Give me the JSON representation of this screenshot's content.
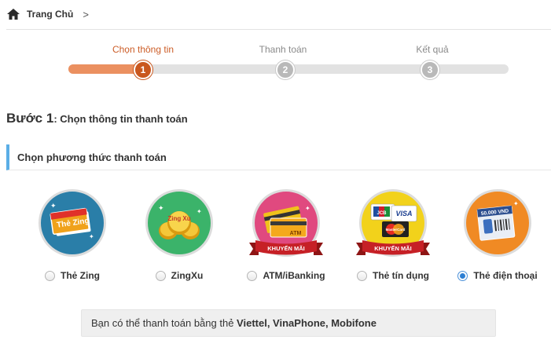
{
  "breadcrumb": {
    "home_label": "Trang Chủ",
    "chevron": ">"
  },
  "steps": [
    {
      "label": "Chọn thông tin",
      "number": "1",
      "active": true
    },
    {
      "label": "Thanh toán",
      "number": "2",
      "active": false
    },
    {
      "label": "Kết quả",
      "number": "3",
      "active": false
    }
  ],
  "progress_fraction": 0.18,
  "step_heading": {
    "prefix": "Bước 1",
    "text": ": Chọn thông tin thanh toán"
  },
  "section_title": "Chọn phương thức thanh toán",
  "methods": [
    {
      "label": "Thẻ Zing",
      "icon": "zing-card-icon",
      "bg": "#2a7ea8",
      "checked": false
    },
    {
      "label": "ZingXu",
      "icon": "zingxu-coins-icon",
      "bg": "#3bb36a",
      "checked": false
    },
    {
      "label": "ATM/iBanking",
      "icon": "atm-cards-icon",
      "bg": "#e0497f",
      "checked": false,
      "ribbon": "KHUYẾN MÃI"
    },
    {
      "label": "Thẻ tín dụng",
      "icon": "credit-cards-icon",
      "bg": "#f2d21b",
      "checked": false,
      "ribbon": "KHUYẾN MÃI"
    },
    {
      "label": "Thẻ điện thoại",
      "icon": "phone-card-icon",
      "bg": "#f08a24",
      "checked": true
    }
  ],
  "card_texts": {
    "zing": "Thẻ Zing",
    "zingxu": "Zing Xu",
    "atm": "ATM",
    "visa": "VISA",
    "jcb": "JCB",
    "mastercard": "MasterCard",
    "phone_value": "50.000 VND"
  },
  "note": {
    "prefix": "Bạn có thể thanh toán bằng thẻ ",
    "providers": "Viettel, VinaPhone, Mobifone"
  },
  "colors": {
    "accent": "#cc5d27",
    "progress": "#eb9060",
    "section_bar": "#5baee6",
    "radio_checked": "#2d7fd3"
  }
}
